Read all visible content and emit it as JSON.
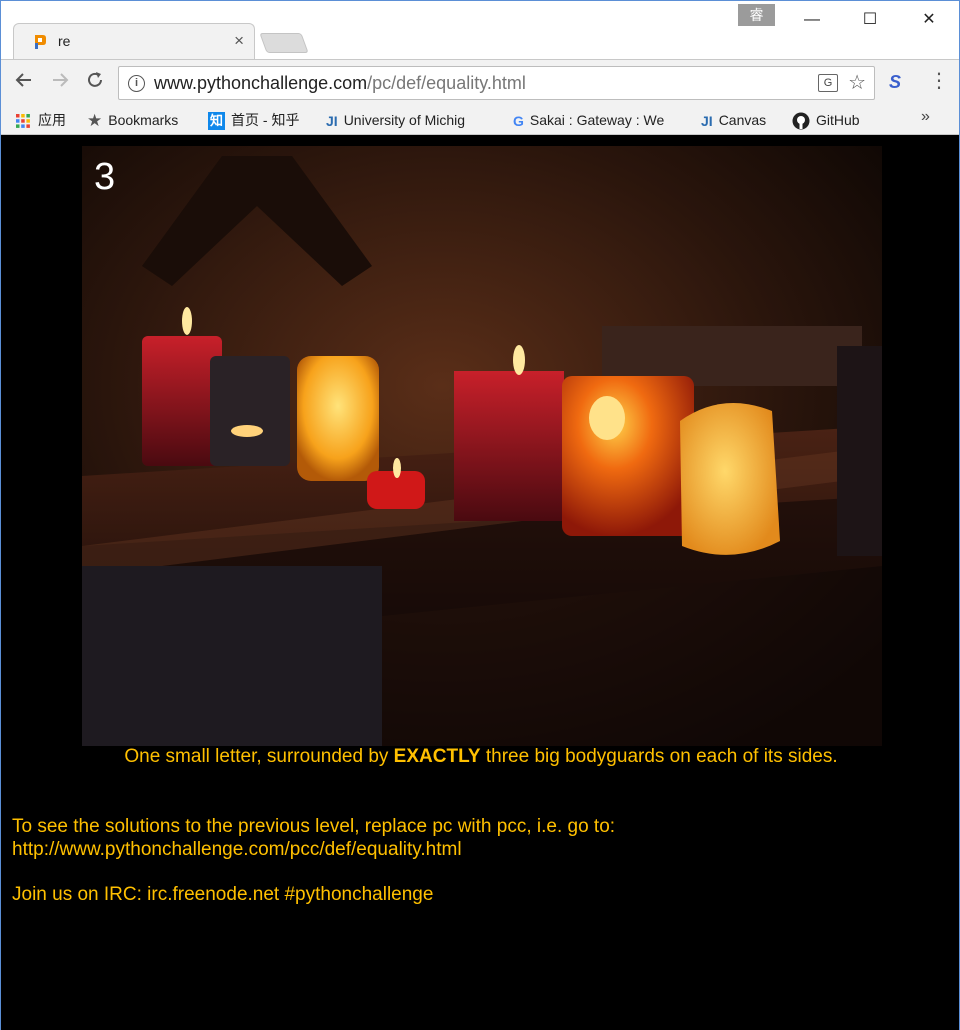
{
  "browser": {
    "tab_title": "re",
    "tab_close": "×",
    "ime_label": "睿",
    "url_domain": "www.pythonchallenge.com",
    "url_path": "/pc/def/equality.html",
    "window_min": "—",
    "window_max": "☐",
    "window_close": "✕"
  },
  "bookmarks": [
    {
      "label": "应用",
      "icon": "apps-icon"
    },
    {
      "label": "Bookmarks",
      "icon": "star-icon"
    },
    {
      "label": "首页 - 知乎",
      "icon": "zhihu-icon",
      "icon_text": "知"
    },
    {
      "label": "University of Michig",
      "icon": "ji-icon",
      "icon_text": "JI"
    },
    {
      "label": "Sakai : Gateway : We",
      "icon": "google-icon",
      "icon_text": "G"
    },
    {
      "label": "Canvas",
      "icon": "ji-icon",
      "icon_text": "JI"
    },
    {
      "label": "GitHub",
      "icon": "github-icon"
    }
  ],
  "bookmarks_more": "»",
  "page": {
    "photo_label": "3",
    "caption_before": "One small letter, surrounded by ",
    "caption_bold": "EXACTLY",
    "caption_after": " three big bodyguards on each of its sides.",
    "solutions_line1": "To see the solutions to the previous level, replace pc with pcc, i.e. go to:",
    "solutions_line2": "http://www.pythonchallenge.com/pcc/def/equality.html",
    "irc_line": "Join us on IRC: irc.freenode.net #pythonchallenge"
  },
  "colors": {
    "page_text": "#ffc000",
    "page_background": "#000000"
  }
}
